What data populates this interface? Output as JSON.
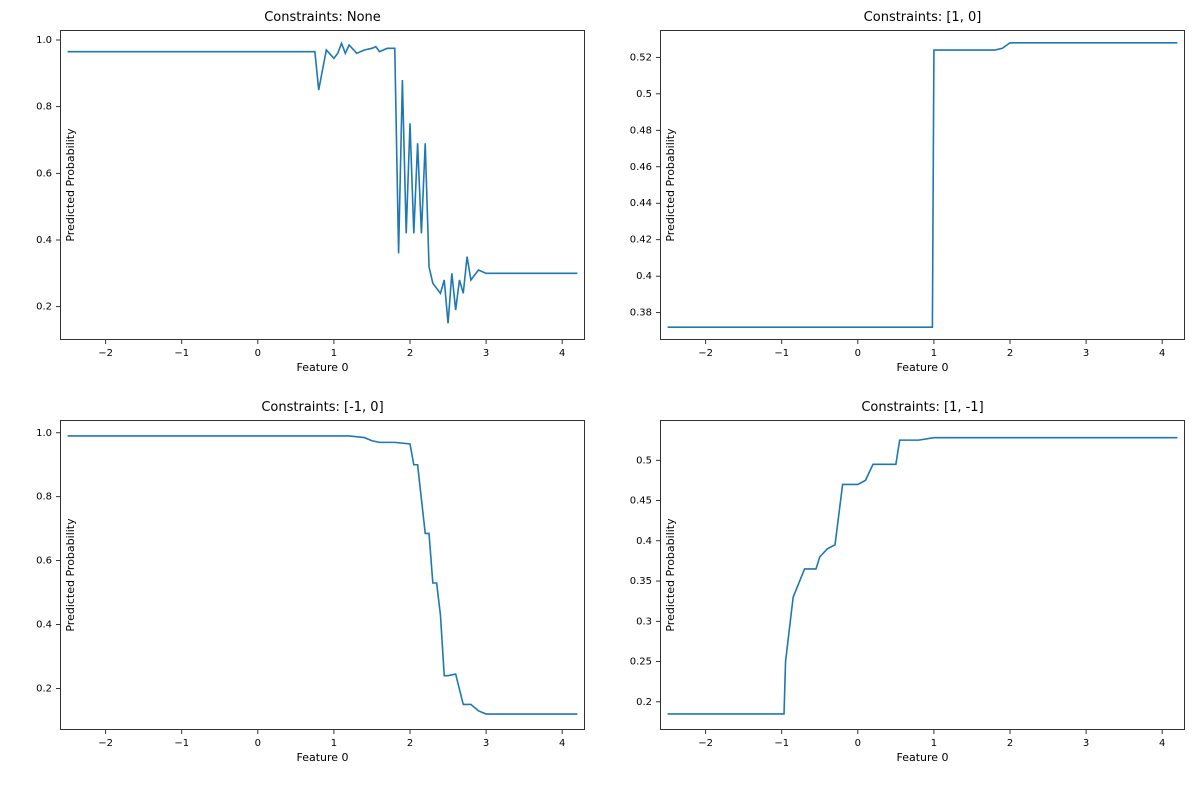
{
  "chart_data": [
    {
      "id": "tl",
      "type": "line",
      "title": "Constraints: None",
      "xlabel": "Feature 0",
      "ylabel": "Predicted Probability",
      "xlim": [
        -2.6,
        4.3
      ],
      "ylim": [
        0.1,
        1.03
      ],
      "xticks": [
        -2,
        -1,
        0,
        1,
        2,
        3,
        4
      ],
      "yticks": [
        0.2,
        0.4,
        0.6,
        0.8,
        1.0
      ],
      "series": [
        {
          "name": "",
          "x": [
            -2.5,
            -2.0,
            -1.5,
            -1.0,
            -0.5,
            0.0,
            0.5,
            0.75,
            0.8,
            0.9,
            1.0,
            1.05,
            1.1,
            1.15,
            1.2,
            1.3,
            1.4,
            1.5,
            1.55,
            1.6,
            1.7,
            1.8,
            1.85,
            1.9,
            1.95,
            2.0,
            2.05,
            2.1,
            2.15,
            2.2,
            2.25,
            2.3,
            2.4,
            2.45,
            2.5,
            2.55,
            2.6,
            2.65,
            2.7,
            2.75,
            2.8,
            2.9,
            3.0,
            3.2,
            3.5,
            4.0,
            4.2
          ],
          "y": [
            0.965,
            0.965,
            0.965,
            0.965,
            0.965,
            0.965,
            0.965,
            0.965,
            0.85,
            0.97,
            0.945,
            0.96,
            0.99,
            0.96,
            0.985,
            0.96,
            0.97,
            0.975,
            0.98,
            0.965,
            0.975,
            0.975,
            0.36,
            0.88,
            0.42,
            0.75,
            0.42,
            0.69,
            0.42,
            0.69,
            0.32,
            0.27,
            0.24,
            0.28,
            0.15,
            0.3,
            0.19,
            0.28,
            0.24,
            0.35,
            0.28,
            0.31,
            0.3,
            0.3,
            0.3,
            0.3,
            0.3
          ]
        }
      ]
    },
    {
      "id": "tr",
      "type": "line",
      "title": "Constraints: [1, 0]",
      "xlabel": "Feature 0",
      "ylabel": "Predicted Probability",
      "xlim": [
        -2.6,
        4.3
      ],
      "ylim": [
        0.365,
        0.535
      ],
      "xticks": [
        -2,
        -1,
        0,
        1,
        2,
        3,
        4
      ],
      "yticks": [
        0.38,
        0.4,
        0.42,
        0.44,
        0.46,
        0.48,
        0.5,
        0.52
      ],
      "series": [
        {
          "name": "",
          "x": [
            -2.5,
            -2.0,
            -1.5,
            -1.0,
            -0.5,
            0.0,
            0.5,
            0.8,
            0.95,
            0.98,
            1.0,
            1.02,
            1.5,
            1.8,
            1.9,
            2.0,
            2.5,
            3.0,
            3.5,
            4.0,
            4.2
          ],
          "y": [
            0.372,
            0.372,
            0.372,
            0.372,
            0.372,
            0.372,
            0.372,
            0.372,
            0.372,
            0.372,
            0.524,
            0.524,
            0.524,
            0.524,
            0.525,
            0.528,
            0.528,
            0.528,
            0.528,
            0.528,
            0.528
          ]
        }
      ]
    },
    {
      "id": "bl",
      "type": "line",
      "title": "Constraints: [-1, 0]",
      "xlabel": "Feature 0",
      "ylabel": "Predicted Probability",
      "xlim": [
        -2.6,
        4.3
      ],
      "ylim": [
        0.07,
        1.04
      ],
      "xticks": [
        -2,
        -1,
        0,
        1,
        2,
        3,
        4
      ],
      "yticks": [
        0.2,
        0.4,
        0.6,
        0.8,
        1.0
      ],
      "series": [
        {
          "name": "",
          "x": [
            -2.5,
            -2.0,
            -1.5,
            -1.0,
            -0.5,
            0.0,
            0.5,
            1.0,
            1.2,
            1.4,
            1.5,
            1.6,
            1.8,
            2.0,
            2.05,
            2.1,
            2.2,
            2.25,
            2.3,
            2.35,
            2.4,
            2.45,
            2.5,
            2.6,
            2.7,
            2.8,
            2.9,
            3.0,
            3.5,
            4.0,
            4.2
          ],
          "y": [
            0.99,
            0.99,
            0.99,
            0.99,
            0.99,
            0.99,
            0.99,
            0.99,
            0.99,
            0.985,
            0.975,
            0.97,
            0.97,
            0.965,
            0.9,
            0.9,
            0.685,
            0.685,
            0.53,
            0.53,
            0.43,
            0.24,
            0.24,
            0.245,
            0.15,
            0.15,
            0.13,
            0.12,
            0.12,
            0.12,
            0.12
          ]
        }
      ]
    },
    {
      "id": "br",
      "type": "line",
      "title": "Constraints: [1, -1]",
      "xlabel": "Feature 0",
      "ylabel": "Predicted Probability",
      "xlim": [
        -2.6,
        4.3
      ],
      "ylim": [
        0.165,
        0.55
      ],
      "xticks": [
        -2,
        -1,
        0,
        1,
        2,
        3,
        4
      ],
      "yticks": [
        0.2,
        0.25,
        0.3,
        0.35,
        0.4,
        0.45,
        0.5
      ],
      "series": [
        {
          "name": "",
          "x": [
            -2.5,
            -2.0,
            -1.5,
            -1.0,
            -0.97,
            -0.95,
            -0.85,
            -0.7,
            -0.6,
            -0.55,
            -0.5,
            -0.4,
            -0.3,
            -0.2,
            -0.1,
            0.0,
            0.1,
            0.2,
            0.3,
            0.4,
            0.5,
            0.55,
            0.6,
            0.8,
            1.0,
            1.5,
            2.0,
            2.5,
            3.0,
            3.5,
            4.0,
            4.2
          ],
          "y": [
            0.185,
            0.185,
            0.185,
            0.185,
            0.185,
            0.25,
            0.33,
            0.365,
            0.365,
            0.365,
            0.38,
            0.39,
            0.395,
            0.47,
            0.47,
            0.47,
            0.475,
            0.495,
            0.495,
            0.495,
            0.495,
            0.525,
            0.525,
            0.525,
            0.528,
            0.528,
            0.528,
            0.528,
            0.528,
            0.528,
            0.528,
            0.528
          ]
        }
      ]
    }
  ]
}
